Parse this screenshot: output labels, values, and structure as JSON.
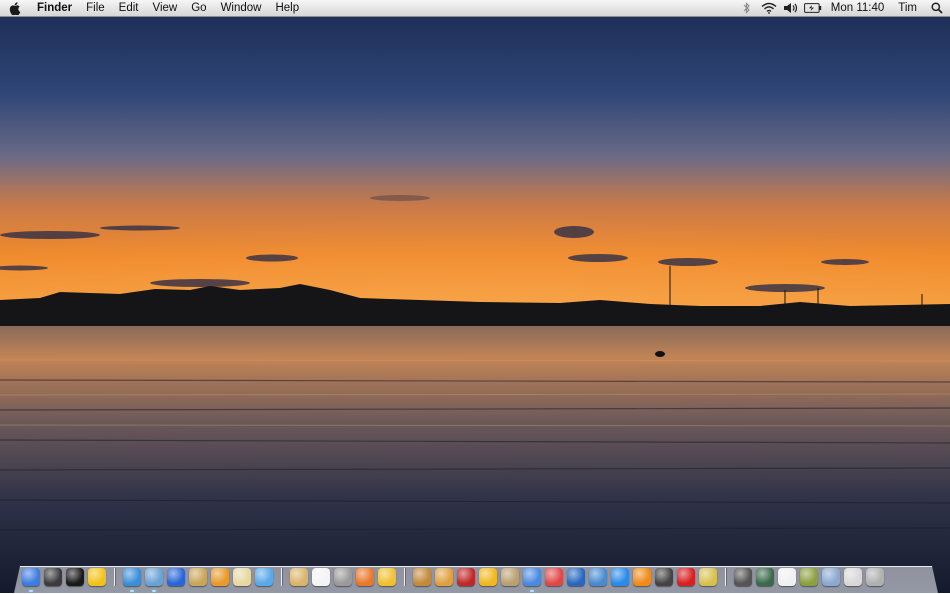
{
  "menubar": {
    "app_name": "Finder",
    "menus": [
      "File",
      "Edit",
      "View",
      "Go",
      "Window",
      "Help"
    ],
    "clock": "Mon 11:40",
    "user": "Tim"
  },
  "status_icons": [
    "bluetooth-icon",
    "wifi-icon",
    "volume-icon",
    "battery-icon",
    "spotlight-icon"
  ],
  "dock": {
    "groups": [
      [
        {
          "name": "finder-icon",
          "color": "#3d7be0",
          "running": true
        },
        {
          "name": "dashboard-icon",
          "color": "#3b3b3b",
          "running": false
        },
        {
          "name": "terminal-icon",
          "color": "#1a1a1a",
          "running": false
        },
        {
          "name": "infinity-app-icon",
          "color": "#f2c21a",
          "running": false
        }
      ],
      [
        {
          "name": "safari-icon",
          "color": "#3a8fd8",
          "running": true
        },
        {
          "name": "mail-icon",
          "color": "#6aa2d6",
          "running": true
        },
        {
          "name": "app-store-icon",
          "color": "#2a66d8",
          "running": false
        },
        {
          "name": "photo-album-icon",
          "color": "#c9a55a",
          "running": false
        },
        {
          "name": "bird-app-icon",
          "color": "#e89a2a",
          "running": false
        },
        {
          "name": "feather-app-icon",
          "color": "#e8d8a0",
          "running": false
        },
        {
          "name": "chat-icon",
          "color": "#5aa8e8",
          "running": false
        }
      ],
      [
        {
          "name": "notes-icon",
          "color": "#d9b46a",
          "running": false
        },
        {
          "name": "calendar-icon",
          "color": "#f4f4f4",
          "running": false
        },
        {
          "name": "disk-utility-icon",
          "color": "#9a9a9a",
          "running": false
        },
        {
          "name": "firefox-icon",
          "color": "#e8782a",
          "running": false
        },
        {
          "name": "stuffit-icon",
          "color": "#f0c030",
          "running": false
        }
      ],
      [
        {
          "name": "iphoto-icon",
          "color": "#c28a3a",
          "running": false
        },
        {
          "name": "photo-booth-icon",
          "color": "#e0a040",
          "running": false
        },
        {
          "name": "book-icon",
          "color": "#c02828",
          "running": false
        },
        {
          "name": "hat-app-icon",
          "color": "#f0b820",
          "running": false
        },
        {
          "name": "owl-app-icon",
          "color": "#b8a070",
          "running": false
        },
        {
          "name": "itunes-icon",
          "color": "#4a8ae0",
          "running": true
        },
        {
          "name": "image-capture-icon",
          "color": "#e04848",
          "running": false
        },
        {
          "name": "screen-app-icon",
          "color": "#2a68c0",
          "running": false
        },
        {
          "name": "preview-icon",
          "color": "#4a8ad0",
          "running": false
        },
        {
          "name": "quicktime-icon",
          "color": "#2a8ae8",
          "running": false
        },
        {
          "name": "vlc-icon",
          "color": "#f08a18",
          "running": false
        },
        {
          "name": "phone-app-icon",
          "color": "#444444",
          "running": false
        },
        {
          "name": "red-app-icon",
          "color": "#d82020",
          "running": false
        },
        {
          "name": "star-app-icon",
          "color": "#d8c050",
          "running": false
        }
      ],
      [
        {
          "name": "system-preferences-icon",
          "color": "#555555",
          "running": false
        },
        {
          "name": "time-machine-icon",
          "color": "#3a6a4a",
          "running": false
        },
        {
          "name": "blank-document-icon",
          "color": "#f0f0f0",
          "running": false
        },
        {
          "name": "flower-app-icon",
          "color": "#8aa040",
          "running": false
        },
        {
          "name": "applications-folder-icon",
          "color": "#8aa8d0",
          "running": false
        },
        {
          "name": "documents-stack-icon",
          "color": "#d8d8d8",
          "running": false
        },
        {
          "name": "trash-icon",
          "color": "#b0b0b0",
          "running": false
        }
      ]
    ]
  }
}
